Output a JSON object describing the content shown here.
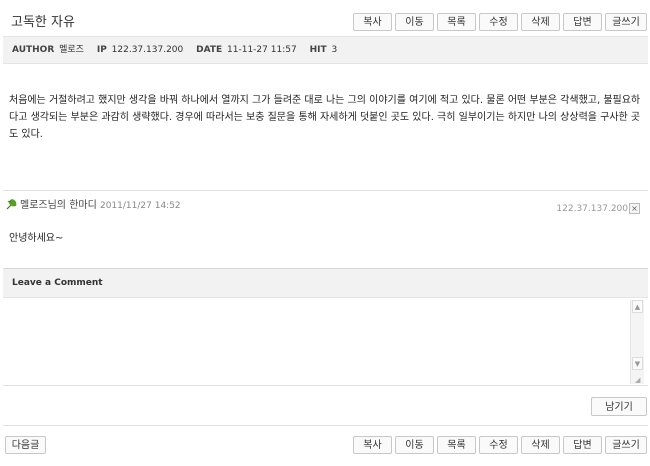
{
  "post": {
    "title": "고독한 자유",
    "meta": {
      "author_key": "AUTHOR",
      "author_val": "멜로즈",
      "ip_key": "IP",
      "ip_val": "122.37.137.200",
      "date_key": "DATE",
      "date_val": "11-11-27 11:57",
      "hit_key": "HIT",
      "hit_val": "3"
    },
    "body": "처음에는 거절하려고 했지만 생각을 바꿔 하나에서 열까지 그가 들려준 대로 나는 그의 이야기를 여기에 적고 있다. 물론 어떤 부분은 각색했고, 불필요하다고 생각되는 부분은 과감히 생략했다. 경우에 따라서는 보충 질문을 통해 자세하게 덧붙인 곳도 있다. 극히 일부이기는 하지만 나의 상상력을 구사한 곳도 있다."
  },
  "toolbar": {
    "copy": "복사",
    "move": "이동",
    "list": "목록",
    "edit": "수정",
    "delete": "삭제",
    "reply": "답변",
    "write": "글쓰기"
  },
  "comment": {
    "author": "멜로즈",
    "suffix": "님의 한마디",
    "date": "2011/11/27 14:52",
    "ip": "122.37.137.200",
    "delete_glyph": "×",
    "text": "안녕하세요~"
  },
  "comment_form": {
    "heading": "Leave a Comment",
    "submit": "남기기"
  },
  "footer": {
    "next": "다음글"
  }
}
